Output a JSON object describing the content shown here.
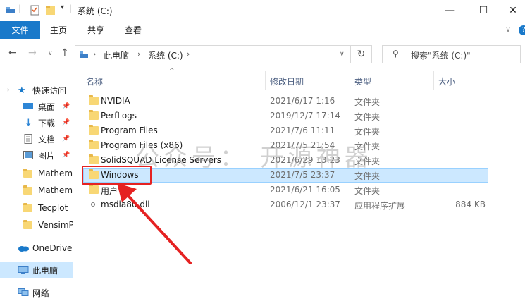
{
  "window": {
    "title": "系统 (C:)",
    "controls": [
      "—",
      "☐",
      "✕"
    ]
  },
  "ribbon": {
    "file": "文件",
    "tabs": [
      "主页",
      "共享",
      "查看"
    ],
    "collapse": "∨"
  },
  "address": {
    "segments": [
      "此电脑",
      "系统 (C:)"
    ],
    "search_placeholder": "搜索\"系统 (C:)\""
  },
  "sidebar": {
    "quick_access": "快速访问",
    "items": [
      {
        "label": "桌面",
        "icon": "desktop-icon",
        "pinned": true
      },
      {
        "label": "下载",
        "icon": "download-icon",
        "pinned": true
      },
      {
        "label": "文档",
        "icon": "document-icon",
        "pinned": true
      },
      {
        "label": "图片",
        "icon": "picture-icon",
        "pinned": true
      },
      {
        "label": "Mathem",
        "icon": "folder-icon",
        "pinned": false
      },
      {
        "label": "Mathem",
        "icon": "folder-icon",
        "pinned": false
      },
      {
        "label": "Tecplot",
        "icon": "folder-icon",
        "pinned": false
      },
      {
        "label": "VensimP",
        "icon": "folder-icon",
        "pinned": false
      }
    ],
    "onedrive": "OneDrive",
    "this_pc": "此电脑",
    "network": "网络"
  },
  "columns": {
    "name": "名称",
    "date": "修改日期",
    "type": "类型",
    "size": "大小"
  },
  "files": [
    {
      "name": "NVIDIA",
      "date": "2021/6/17 1:16",
      "type": "文件夹",
      "size": "",
      "icon": "folder"
    },
    {
      "name": "PerfLogs",
      "date": "2019/12/7 17:14",
      "type": "文件夹",
      "size": "",
      "icon": "folder"
    },
    {
      "name": "Program Files",
      "date": "2021/7/6 11:11",
      "type": "文件夹",
      "size": "",
      "icon": "folder"
    },
    {
      "name": "Program Files (x86)",
      "date": "2021/7/5 21:54",
      "type": "文件夹",
      "size": "",
      "icon": "folder"
    },
    {
      "name": "SolidSQUAD License Servers",
      "date": "2021/6/29 13:23",
      "type": "文件夹",
      "size": "",
      "icon": "folder"
    },
    {
      "name": "Windows",
      "date": "2021/7/5 23:37",
      "type": "文件夹",
      "size": "",
      "icon": "folder"
    },
    {
      "name": "用户",
      "date": "2021/6/21 16:05",
      "type": "文件夹",
      "size": "",
      "icon": "folder"
    },
    {
      "name": "msdia80.dll",
      "date": "2006/12/1 23:37",
      "type": "应用程序扩展",
      "size": "884 KB",
      "icon": "dll"
    }
  ],
  "watermark": "公众号： 开源神器",
  "colors": {
    "accent": "#1979ca",
    "selection": "#cce8ff",
    "annotation": "#e52222",
    "folder": "#f8d775"
  }
}
